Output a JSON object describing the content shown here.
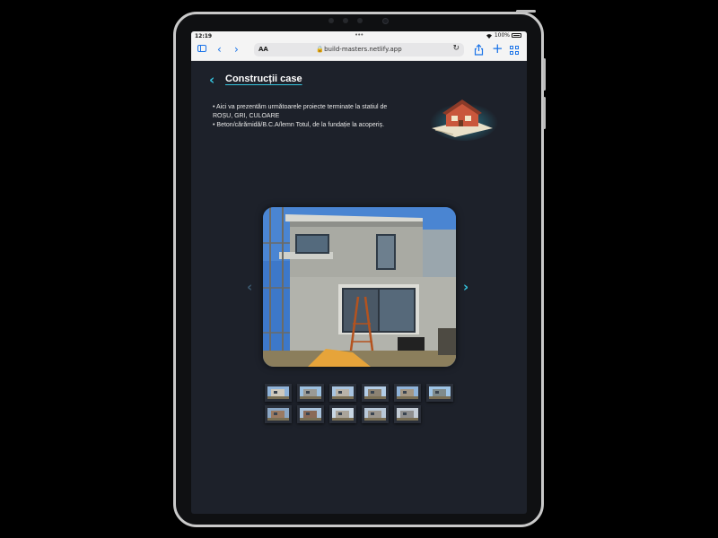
{
  "status_bar": {
    "time": "12:19",
    "battery_text": "100%"
  },
  "browser": {
    "url": "build-masters.netlify.app",
    "text_size_label": "AA"
  },
  "page": {
    "title": "Construcții case",
    "bullets": [
      "• Aici va prezentăm următoarele proiecte terminate la statiul de ROȘU, GRI, CULOARE",
      "• Beton/cărămidă/B.C.A/lemn Totul, de la fundație la acoperiș."
    ]
  },
  "gallery": {
    "thumbnails": [
      {
        "sky": "#8fb3d9",
        "wall": "#cfc9bd"
      },
      {
        "sky": "#9cc0e0",
        "wall": "#9a9a95"
      },
      {
        "sky": "#a8c4e0",
        "wall": "#b9b3a8"
      },
      {
        "sky": "#b3cde6",
        "wall": "#8c8273"
      },
      {
        "sky": "#8fb3d9",
        "wall": "#a39785"
      },
      {
        "sky": "#9ec4e6",
        "wall": "#7f8b8c"
      },
      {
        "sky": "#8aa6c4",
        "wall": "#9a7a62"
      },
      {
        "sky": "#a9c2db",
        "wall": "#8a6a58"
      },
      {
        "sky": "#c8d6e3",
        "wall": "#aaa49a"
      },
      {
        "sky": "#b8c8d8",
        "wall": "#9b968e"
      },
      {
        "sky": "#c3ccd6",
        "wall": "#8f8f8f"
      }
    ]
  },
  "colors": {
    "accent": "#35c3dd",
    "background": "#1d212a"
  }
}
